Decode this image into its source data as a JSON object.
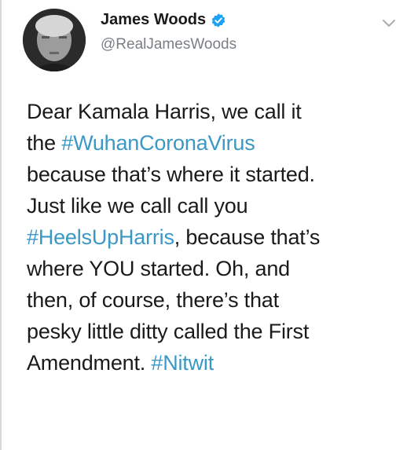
{
  "author": {
    "display_name": "James Woods",
    "handle": "@RealJamesWoods",
    "verified_icon": "verified-badge-icon",
    "avatar_icon": "profile-avatar"
  },
  "menu_icon": "chevron-down-icon",
  "colors": {
    "hashtag": "#3a98c6",
    "verified": "#1da1f2",
    "text": "#1a1a1a",
    "handle": "#7a7f84"
  },
  "tweet": {
    "l1": "Dear Kamala Harris, we call it",
    "l2_pre": "the ",
    "l2_tag": "#WuhanCoronaVirus",
    "l3": "because that’s where it started.",
    "l4": "Just like we call call you",
    "l5_tag": "#HeelsUpHarris",
    "l5_post": ", because that’s",
    "l6": "where YOU started. Oh, and",
    "l7": "then, of course, there’s that",
    "l8": "pesky little ditty called the First",
    "l9_pre": "Amendment. ",
    "l9_tag": "#Nitwit"
  }
}
